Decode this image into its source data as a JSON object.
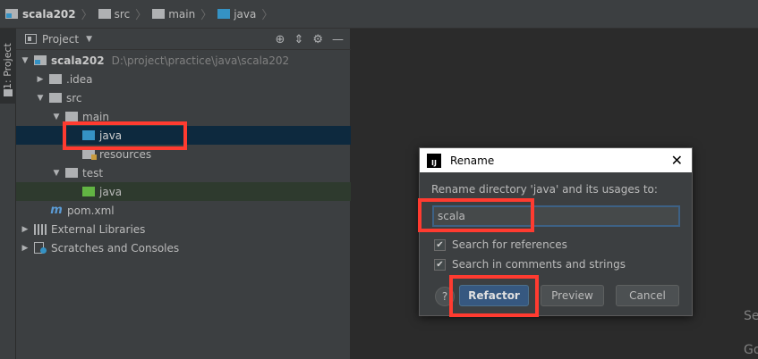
{
  "breadcrumb": {
    "items": [
      "scala202",
      "src",
      "main",
      "java"
    ],
    "separator": "〉"
  },
  "stripe": {
    "tab_label": "1: Project"
  },
  "panel": {
    "title": "Project",
    "tree": {
      "root_label": "scala202",
      "root_path": "D:\\project\\practice\\java\\scala202",
      "idea": ".idea",
      "src": "src",
      "main": "main",
      "java": "java",
      "resources": "resources",
      "test": "test",
      "test_java": "java",
      "pom": "pom.xml",
      "external_libraries": "External Libraries",
      "scratches": "Scratches and Consoles"
    }
  },
  "dialog": {
    "title": "Rename",
    "message": "Rename directory 'java' and its usages to:",
    "input_value": "scala",
    "search_references": "Search for references",
    "search_comments": "Search in comments and strings",
    "help": "?",
    "refactor": "Refactor",
    "preview": "Preview",
    "cancel": "Cancel"
  },
  "editor_edge": {
    "line1": "Se",
    "line2": "Go"
  },
  "colors": {
    "accent": "#365880",
    "selection": "#0d293e",
    "highlight": "#ff3b30"
  }
}
